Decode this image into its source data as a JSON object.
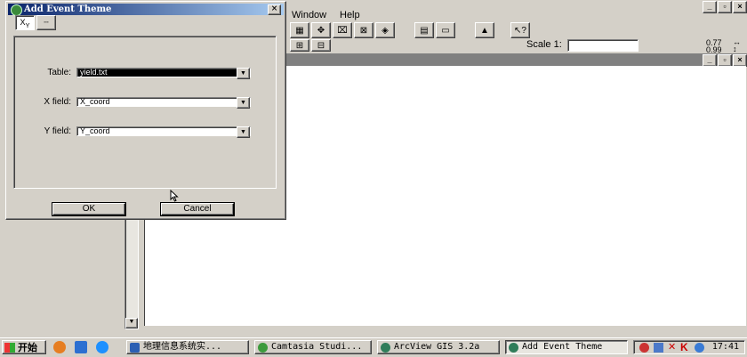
{
  "app": {
    "menu": {
      "window": "Window",
      "help": "Help"
    },
    "scale_label": "Scale 1:",
    "scale_value": "",
    "coord_x": "0.77",
    "coord_y": "0.99"
  },
  "dialog": {
    "title": "Add Event Theme",
    "fields": [
      {
        "label": "Table:",
        "value": "yield.txt"
      },
      {
        "label": "X field:",
        "value": "X_coord"
      },
      {
        "label": "Y field:",
        "value": "Y_coord"
      }
    ],
    "ok_label": "OK",
    "cancel_label": "Cancel"
  },
  "taskbar": {
    "start_label": "开始",
    "items": [
      {
        "label": "地理信息系统实...",
        "icon": "word-icon"
      },
      {
        "label": "Camtasia Studi...",
        "icon": "camtasia-icon"
      },
      {
        "label": "ArcView GIS 3.2a",
        "icon": "arcview-icon"
      },
      {
        "label": "Add Event Theme",
        "icon": "arcview-icon",
        "active": true
      }
    ],
    "clock": "17:41"
  },
  "colors": {
    "title_active_start": "#0a246a",
    "title_active_end": "#a6caf0",
    "face": "#d4d0c8"
  }
}
